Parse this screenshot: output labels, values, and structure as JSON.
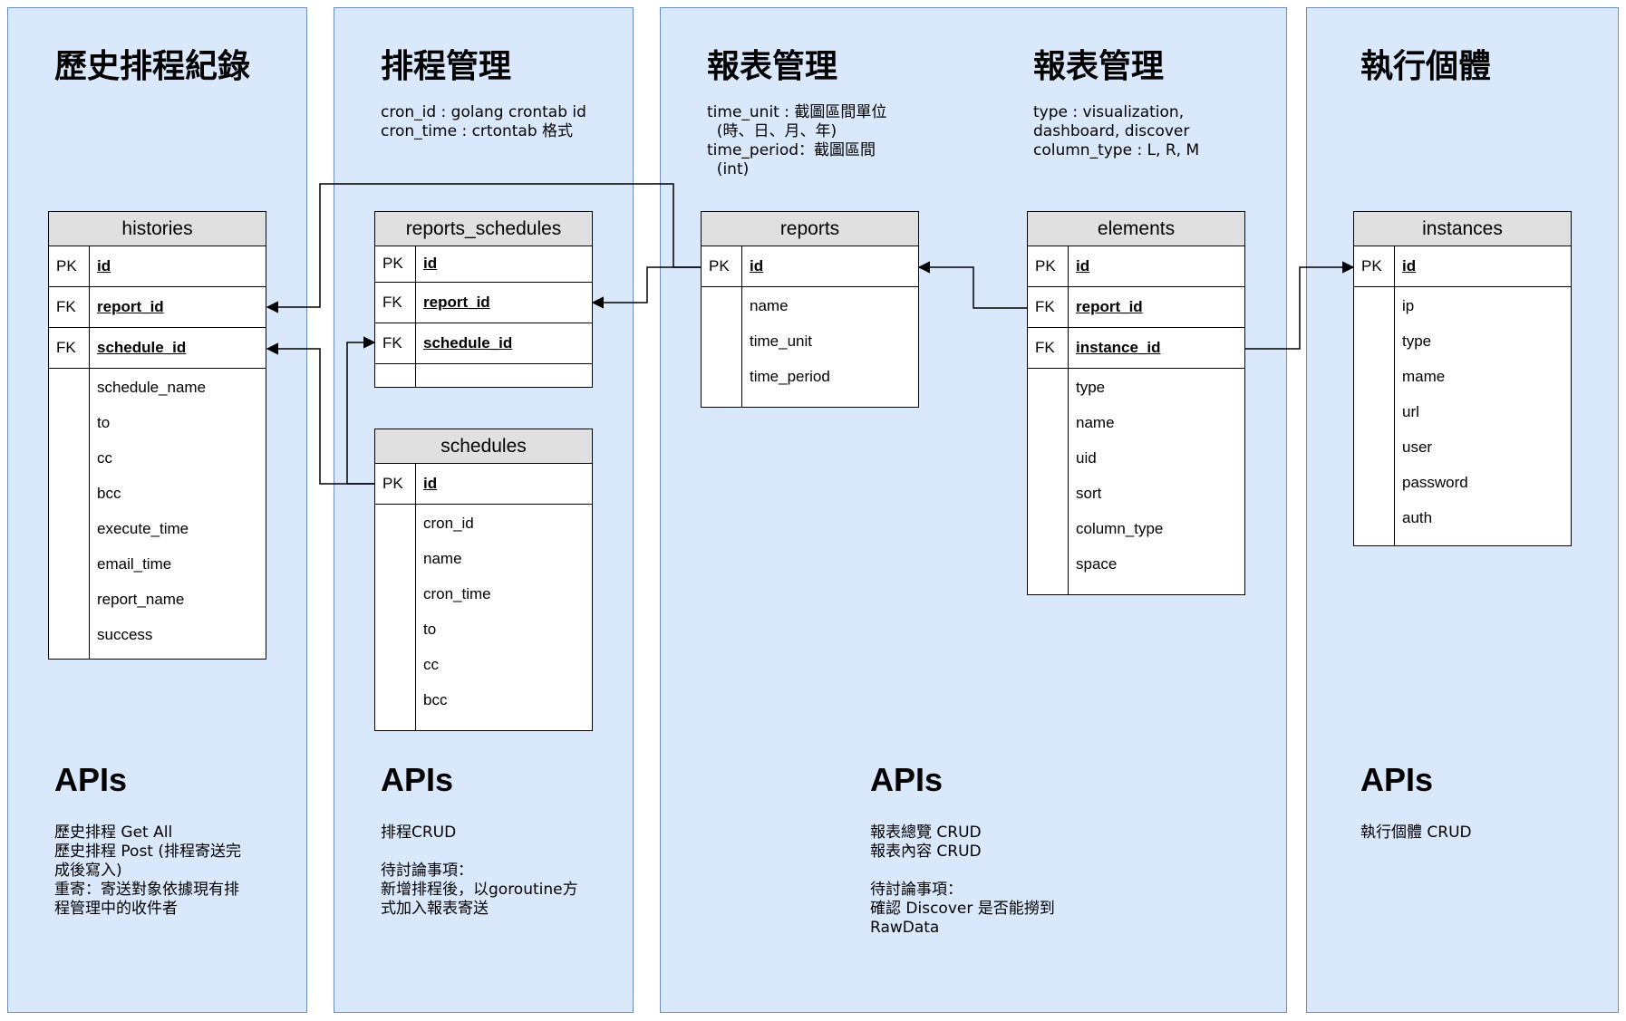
{
  "panels": [
    {
      "title": "歷史排程紀錄",
      "api_title": "APIs",
      "api_text": "歷史排程 Get All\n歷史排程 Post (排程寄送完\n成後寫入)\n重寄：寄送對象依據現有排\n程管理中的收件者"
    },
    {
      "title": "排程管理",
      "note": "cron_id : golang crontab id\ncron_time : crtontab 格式",
      "api_title": "APIs",
      "api_text": "排程CRUD\n\n待討論事項：\n新增排程後，以goroutine方\n式加入報表寄送"
    },
    {
      "title": "報表管理",
      "title2": "報表管理",
      "note": "time_unit : 截圖區間單位\n  (時、日、月、年)\ntime_period：截圖區間\n  (int)",
      "note2": "type : visualization,\ndashboard, discover\ncolumn_type : L, R, M",
      "api_title": "APIs",
      "api_text": "報表總覽 CRUD\n報表內容 CRUD\n\n待討論事項：\n確認 Discover 是否能撈到\nRawData"
    },
    {
      "title": "執行個體",
      "api_title": "APIs",
      "api_text": "執行個體 CRUD"
    }
  ],
  "entities": {
    "histories": {
      "name": "histories",
      "keys": [
        [
          "PK",
          "id"
        ],
        [
          "FK",
          "report_id"
        ],
        [
          "FK",
          "schedule_id"
        ]
      ],
      "fields": [
        "schedule_name",
        "to",
        "cc",
        "bcc",
        "execute_time",
        "email_time",
        "report_name",
        "success"
      ]
    },
    "reports_schedules": {
      "name": "reports_schedules",
      "keys": [
        [
          "PK",
          "id"
        ],
        [
          "FK",
          "report_id"
        ],
        [
          "FK",
          "schedule_id"
        ]
      ],
      "fields": []
    },
    "schedules": {
      "name": "schedules",
      "keys": [
        [
          "PK",
          "id"
        ]
      ],
      "fields": [
        "cron_id",
        "name",
        "cron_time",
        "to",
        "cc",
        "bcc"
      ]
    },
    "reports": {
      "name": "reports",
      "keys": [
        [
          "PK",
          "id"
        ]
      ],
      "fields": [
        "name",
        "time_unit",
        "time_period"
      ]
    },
    "elements": {
      "name": "elements",
      "keys": [
        [
          "PK",
          "id"
        ],
        [
          "FK",
          "report_id"
        ],
        [
          "FK",
          "instance_id"
        ]
      ],
      "fields": [
        "type",
        "name",
        "uid",
        "sort",
        "column_type",
        "space"
      ]
    },
    "instances": {
      "name": "instances",
      "keys": [
        [
          "PK",
          "id"
        ]
      ],
      "fields": [
        "ip",
        "type",
        "mame",
        "url",
        "user",
        "password",
        "auth"
      ]
    }
  },
  "colors": {
    "panel_fill": "#dae8fc",
    "panel_border": "#6c8ebf",
    "entity_header": "#e0e0e0"
  }
}
